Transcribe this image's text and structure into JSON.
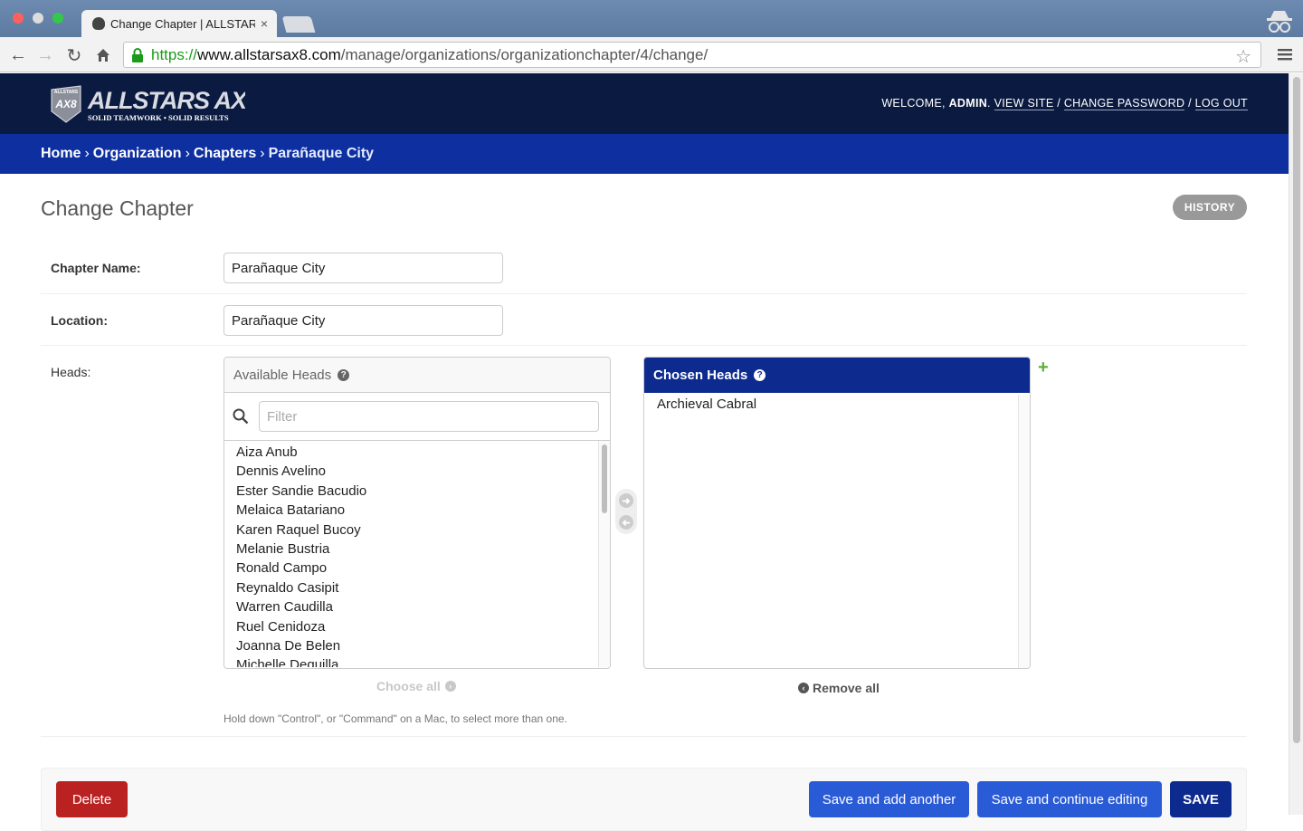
{
  "browser": {
    "tab_title": "Change Chapter | ALLSTARS",
    "tab_close": "×",
    "url_scheme": "https://",
    "url_host": "www.allstarsax8.com",
    "url_path": "/manage/organizations/organizationchapter/4/change/"
  },
  "header": {
    "logo_top": "ALLSTARS",
    "logo_text": "ALLSTARS AX8",
    "logo_tagline": "SOLID TEAMWORK • SOLID RESULTS",
    "welcome": "WELCOME,",
    "user": "ADMIN",
    "view_site": "VIEW SITE",
    "change_password": "CHANGE PASSWORD",
    "log_out": "LOG OUT",
    "separator": "/"
  },
  "breadcrumbs": {
    "home": "Home",
    "organization": "Organization",
    "chapters": "Chapters",
    "current": "Parañaque City",
    "sep": "›"
  },
  "page": {
    "title": "Change Chapter",
    "history_button": "HISTORY"
  },
  "form": {
    "chapter_name_label": "Chapter Name:",
    "chapter_name_value": "Parañaque City",
    "location_label": "Location:",
    "location_value": "Parañaque City",
    "heads_label": "Heads:",
    "available_title": "Available Heads",
    "filter_placeholder": "Filter",
    "available_options": [
      "Aiza Anub",
      "Dennis Avelino",
      "Ester Sandie Bacudio",
      "Melaica Batariano",
      "Karen Raquel Bucoy",
      "Melanie Bustria",
      "Ronald Campo",
      "Reynaldo Casipit",
      "Warren Caudilla",
      "Ruel Cenidoza",
      "Joanna De Belen",
      "Michelle Dequilla"
    ],
    "chosen_title": "Chosen Heads",
    "chosen_options": [
      "Archieval Cabral"
    ],
    "choose_all": "Choose all",
    "remove_all": "Remove all",
    "help_text": "Hold down \"Control\", or \"Command\" on a Mac, to select more than one.",
    "add_related": "+"
  },
  "submit": {
    "delete": "Delete",
    "save_add_another": "Save and add another",
    "save_continue": "Save and continue editing",
    "save": "SAVE"
  },
  "colors": {
    "header_bg": "#0b1a40",
    "breadcrumb_bg": "#0d2fa0",
    "chosen_header_bg": "#0d2a8f",
    "delete": "#ba2121",
    "primary_button": "#2a5bd6",
    "save_button": "#0d2a8f"
  }
}
